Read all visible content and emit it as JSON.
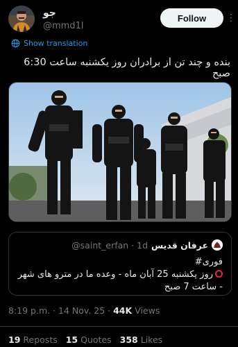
{
  "author": {
    "display_name": "جو",
    "handle": "@mmd1l",
    "follow_label": "Follow",
    "more_icon": "more-vertical-icon"
  },
  "translate": {
    "label": "Show translation",
    "icon": "globe-icon",
    "color": "#1d9bf0"
  },
  "tweet": {
    "text": "بنده و چند تن از برادران روز یکشنبه ساعت 6:30 صبح",
    "media_alt": "photo of masked armed men in black uniforms"
  },
  "quote": {
    "display_name": "عرفان قدیس",
    "handle": "@saint_erfan · 1d",
    "line1": "فوری#",
    "line2": "روز یکشنبه 25 آبان ماه - وعده ما در مترو های شهر - ساعت 7 صبح",
    "status_icon": "red-circle-icon",
    "status_color": "#f4212e"
  },
  "meta": {
    "time": "8:19 p.m. · 14 Nov. 25 · ",
    "views_count": "44K",
    "views_label": "Views"
  },
  "stats": {
    "reposts_count": "19",
    "reposts_label": "Reposts",
    "quotes_count": "15",
    "quotes_label": "Quotes",
    "likes_count": "358",
    "likes_label": "Likes"
  },
  "colors": {
    "background": "#000000",
    "text": "#e7e9ea",
    "secondary": "#71767b",
    "border": "#2f3336"
  }
}
